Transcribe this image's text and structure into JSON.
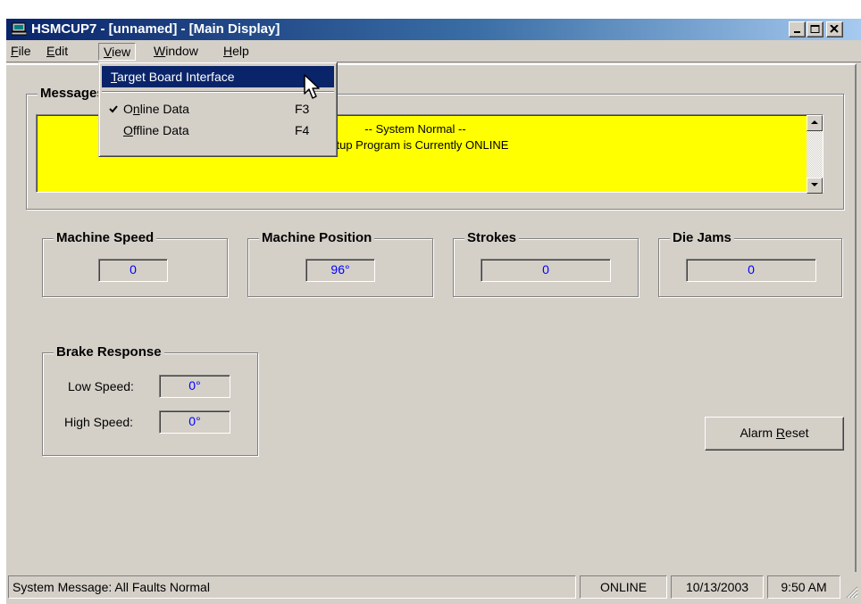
{
  "window": {
    "title": "HSMCUP7 - [unnamed] - [Main Display]"
  },
  "menubar": {
    "file": {
      "pre": "",
      "key": "F",
      "post": "ile"
    },
    "edit": {
      "pre": "",
      "key": "E",
      "post": "dit"
    },
    "view": {
      "pre": "",
      "key": "V",
      "post": "iew"
    },
    "window": {
      "pre": "",
      "key": "W",
      "post": "indow"
    },
    "help": {
      "pre": "",
      "key": "H",
      "post": "elp"
    }
  },
  "view_menu": {
    "target_board": {
      "key": "T",
      "post": "arget Board Interface"
    },
    "online": {
      "pre": "O",
      "key": "n",
      "post": "line Data",
      "shortcut": "F3",
      "checked": true
    },
    "offline": {
      "pre": "",
      "key": "O",
      "post": "ffline Data",
      "shortcut": "F4"
    }
  },
  "messages": {
    "title": "Messages",
    "line1": "-- System Normal --",
    "line2": "Setup Program is Currently ONLINE"
  },
  "machine_speed": {
    "title": "Machine Speed",
    "value": "0"
  },
  "machine_position": {
    "title": "Machine Position",
    "value": "96°"
  },
  "strokes": {
    "title": "Strokes",
    "value": "0"
  },
  "die_jams": {
    "title": "Die Jams",
    "value": "0"
  },
  "brake_response": {
    "title": "Brake Response",
    "low_label": "Low Speed:",
    "low_value": "0°",
    "high_label": "High Speed:",
    "high_value": "0°"
  },
  "alarm_reset": {
    "pre": "Alarm ",
    "key": "R",
    "post": "eset"
  },
  "statusbar": {
    "message": "System Message:  All Faults Normal",
    "mode": "ONLINE",
    "date": "10/13/2003",
    "time": "9:50 AM"
  },
  "colors": {
    "title_gradient_start": "#0a246a",
    "message_background": "#ffff00",
    "value_text": "#0000ff",
    "face": "#d4d0c8"
  }
}
